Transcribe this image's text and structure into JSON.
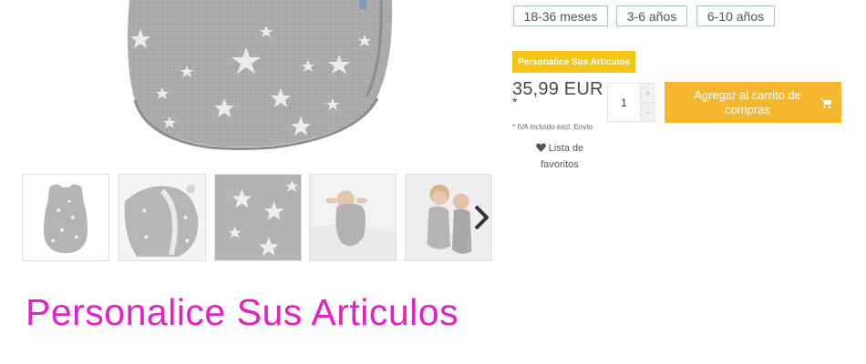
{
  "product": {
    "sizes": [
      "18-36 meses",
      "3-6 años",
      "6-10 años"
    ],
    "personalize_badge": "Personalice Sus Artículos",
    "price": "35,99 EUR",
    "price_asterisk": "*",
    "quantity": "1",
    "qty_plus": "+",
    "qty_minus": "−",
    "add_to_cart": "Agregar al carrito de compras",
    "tax_note": "* IVA incluido excl. Envío",
    "wishlist": "Lista de favoritos"
  },
  "gallery": {
    "thumbnail_count": 5,
    "next_arrow_icon": "chevron-right-icon"
  },
  "caption": "Personalice Sus Articulos",
  "colors": {
    "badge": "#f3c516",
    "cart_button": "#f5b72e",
    "caption": "#e521c4",
    "size_border": "#a9cbb2",
    "fabric": "#a8a8a8"
  }
}
